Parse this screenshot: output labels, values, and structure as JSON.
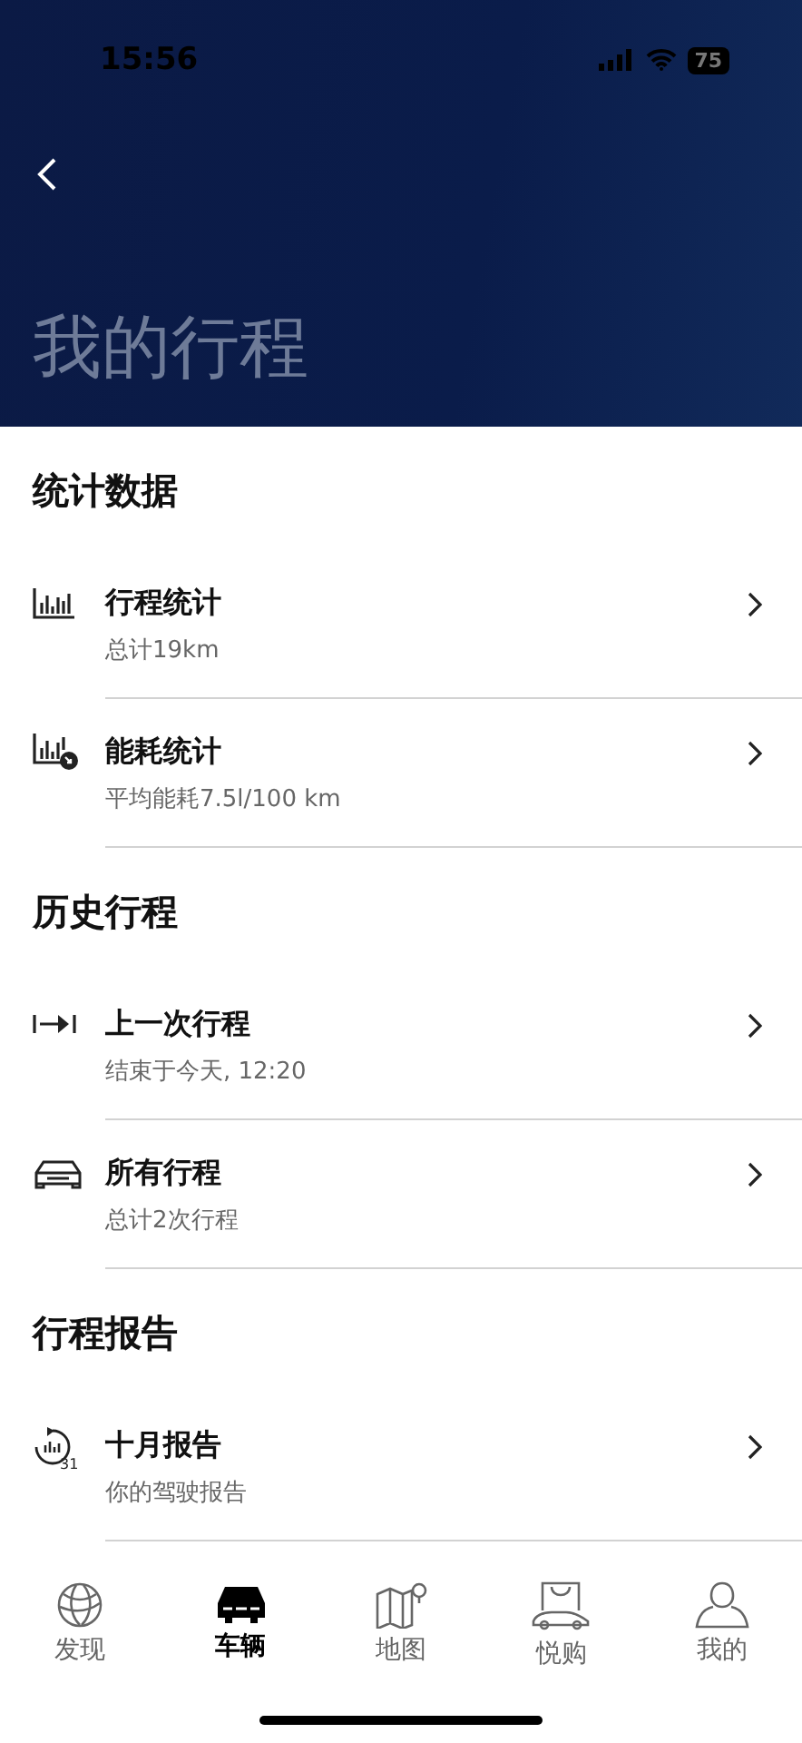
{
  "status_bar": {
    "time": "15:56",
    "battery": "75"
  },
  "header": {
    "title": "我的行程"
  },
  "sections": [
    {
      "heading": "统计数据",
      "items": [
        {
          "kind": "trip-stats",
          "title": "行程统计",
          "subtitle": "总计19km"
        },
        {
          "kind": "energy",
          "title": "能耗统计",
          "subtitle": "平均能耗7.5l/100 km"
        }
      ]
    },
    {
      "heading": "历史行程",
      "items": [
        {
          "kind": "last-trip",
          "title": "上一次行程",
          "subtitle": "结束于今天, 12:20"
        },
        {
          "kind": "all-trips",
          "title": "所有行程",
          "subtitle": "总计2次行程"
        }
      ]
    },
    {
      "heading": "行程报告",
      "items": [
        {
          "kind": "report",
          "title": "十月报告",
          "subtitle": "你的驾驶报告",
          "icon_label": "31"
        }
      ]
    }
  ],
  "tabs": [
    {
      "kind": "globe",
      "label": "发现",
      "selected": false
    },
    {
      "kind": "car",
      "label": "车辆",
      "selected": true
    },
    {
      "kind": "map",
      "label": "地图",
      "selected": false
    },
    {
      "kind": "shop",
      "label": "悦购",
      "selected": false
    },
    {
      "kind": "person",
      "label": "我的",
      "selected": false
    }
  ]
}
